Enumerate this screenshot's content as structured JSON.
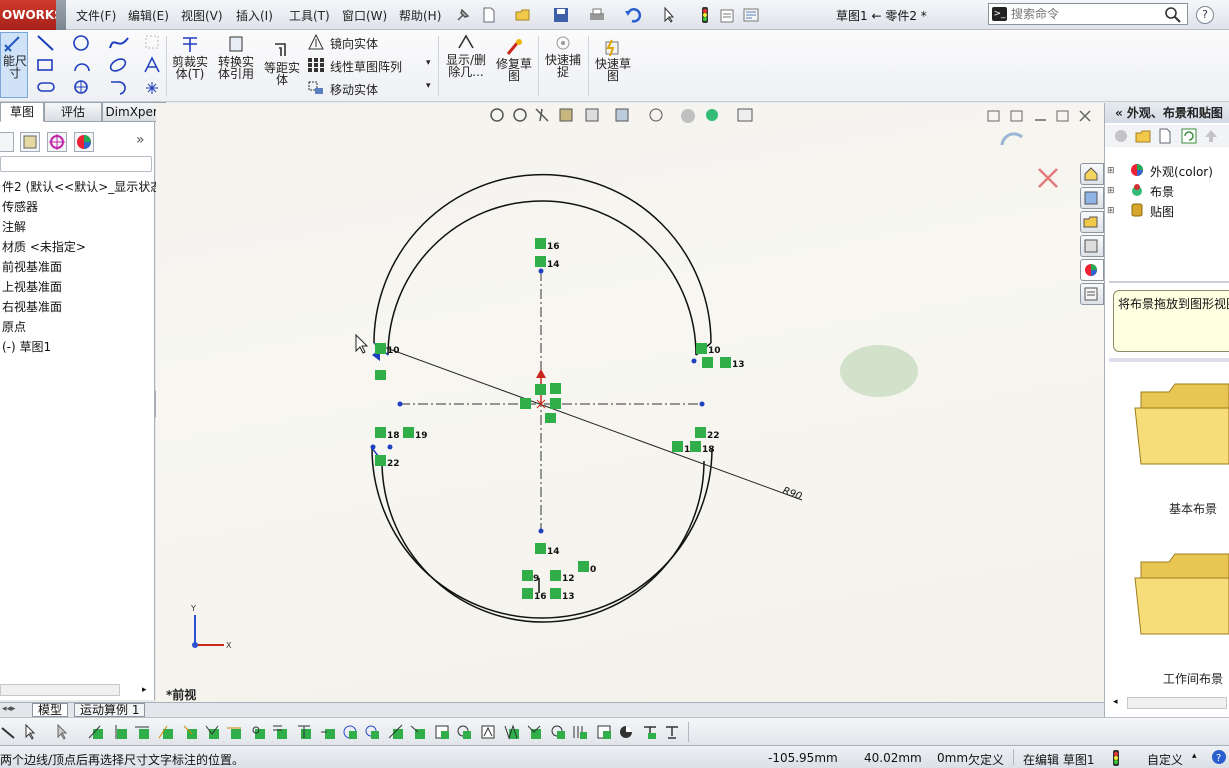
{
  "menubar": {
    "logo": "OWORKS",
    "items": [
      "文件(F)",
      "编辑(E)",
      "视图(V)",
      "插入(I)",
      "工具(T)",
      "窗口(W)",
      "帮助(H)"
    ],
    "doc_title": "草图1 ← 零件2 *",
    "search_placeholder": "搜索命令",
    "help": "?"
  },
  "ribbon": {
    "smart_dim": "能尺\n寸",
    "trim": "剪裁实\n体(T)",
    "convert": "转换实\n体引用",
    "offset": "等距实\n体",
    "mirror": "镜向实体",
    "linear_pattern": "线性草图阵列",
    "move": "移动实体",
    "show_delete": "显示/删\n除几...",
    "repair": "修复草\n图",
    "quick_snap": "快速捕\n捉",
    "rapid_sketch": "快速草\n图"
  },
  "cm_tabs": [
    "草图",
    "评估",
    "DimXpert"
  ],
  "tree": {
    "items": [
      "件2  (默认<<默认>_显示状态",
      "传感器",
      "注解",
      "材质 <未指定>",
      "前视基准面",
      "上视基准面",
      "右视基准面",
      "原点",
      "(-) 草图1"
    ]
  },
  "graphics": {
    "view_label": "*前视",
    "dimension": "R90",
    "relations": [
      {
        "label": "16"
      },
      {
        "label": "14"
      },
      {
        "label": "10"
      },
      {
        "label": "10"
      },
      {
        "label": "13"
      },
      {
        "label": "18"
      },
      {
        "label": "19"
      },
      {
        "label": "22"
      },
      {
        "label": "22"
      },
      {
        "label": "19"
      },
      {
        "label": "18"
      },
      {
        "label": "14"
      },
      {
        "label": "9"
      },
      {
        "label": "12"
      },
      {
        "label": "0"
      },
      {
        "label": "16"
      },
      {
        "label": "13"
      }
    ],
    "triad": {
      "y": "Y",
      "x": "X"
    }
  },
  "task_pane": {
    "header": "«  外观、布景和贴图",
    "tree": [
      "外观(color)",
      "布景",
      "贴图"
    ],
    "hint": "将布景拖放到图形视图",
    "folders": [
      "基本布景",
      "工作间布景"
    ]
  },
  "model_tabs": [
    "模型",
    "运动算例 1"
  ],
  "status": {
    "message": "两个边线/顶点后再选择尺寸文字标注的位置。",
    "x": "-105.95mm",
    "y": "40.02mm",
    "z": "0mm",
    "state": "欠定义",
    "editing": "在编辑 草图1",
    "custom": "自定义"
  },
  "colors": {
    "relation_green": "#2fae4a",
    "sketch_blue": "#1e3fbf",
    "accent_red": "#c8281c"
  }
}
